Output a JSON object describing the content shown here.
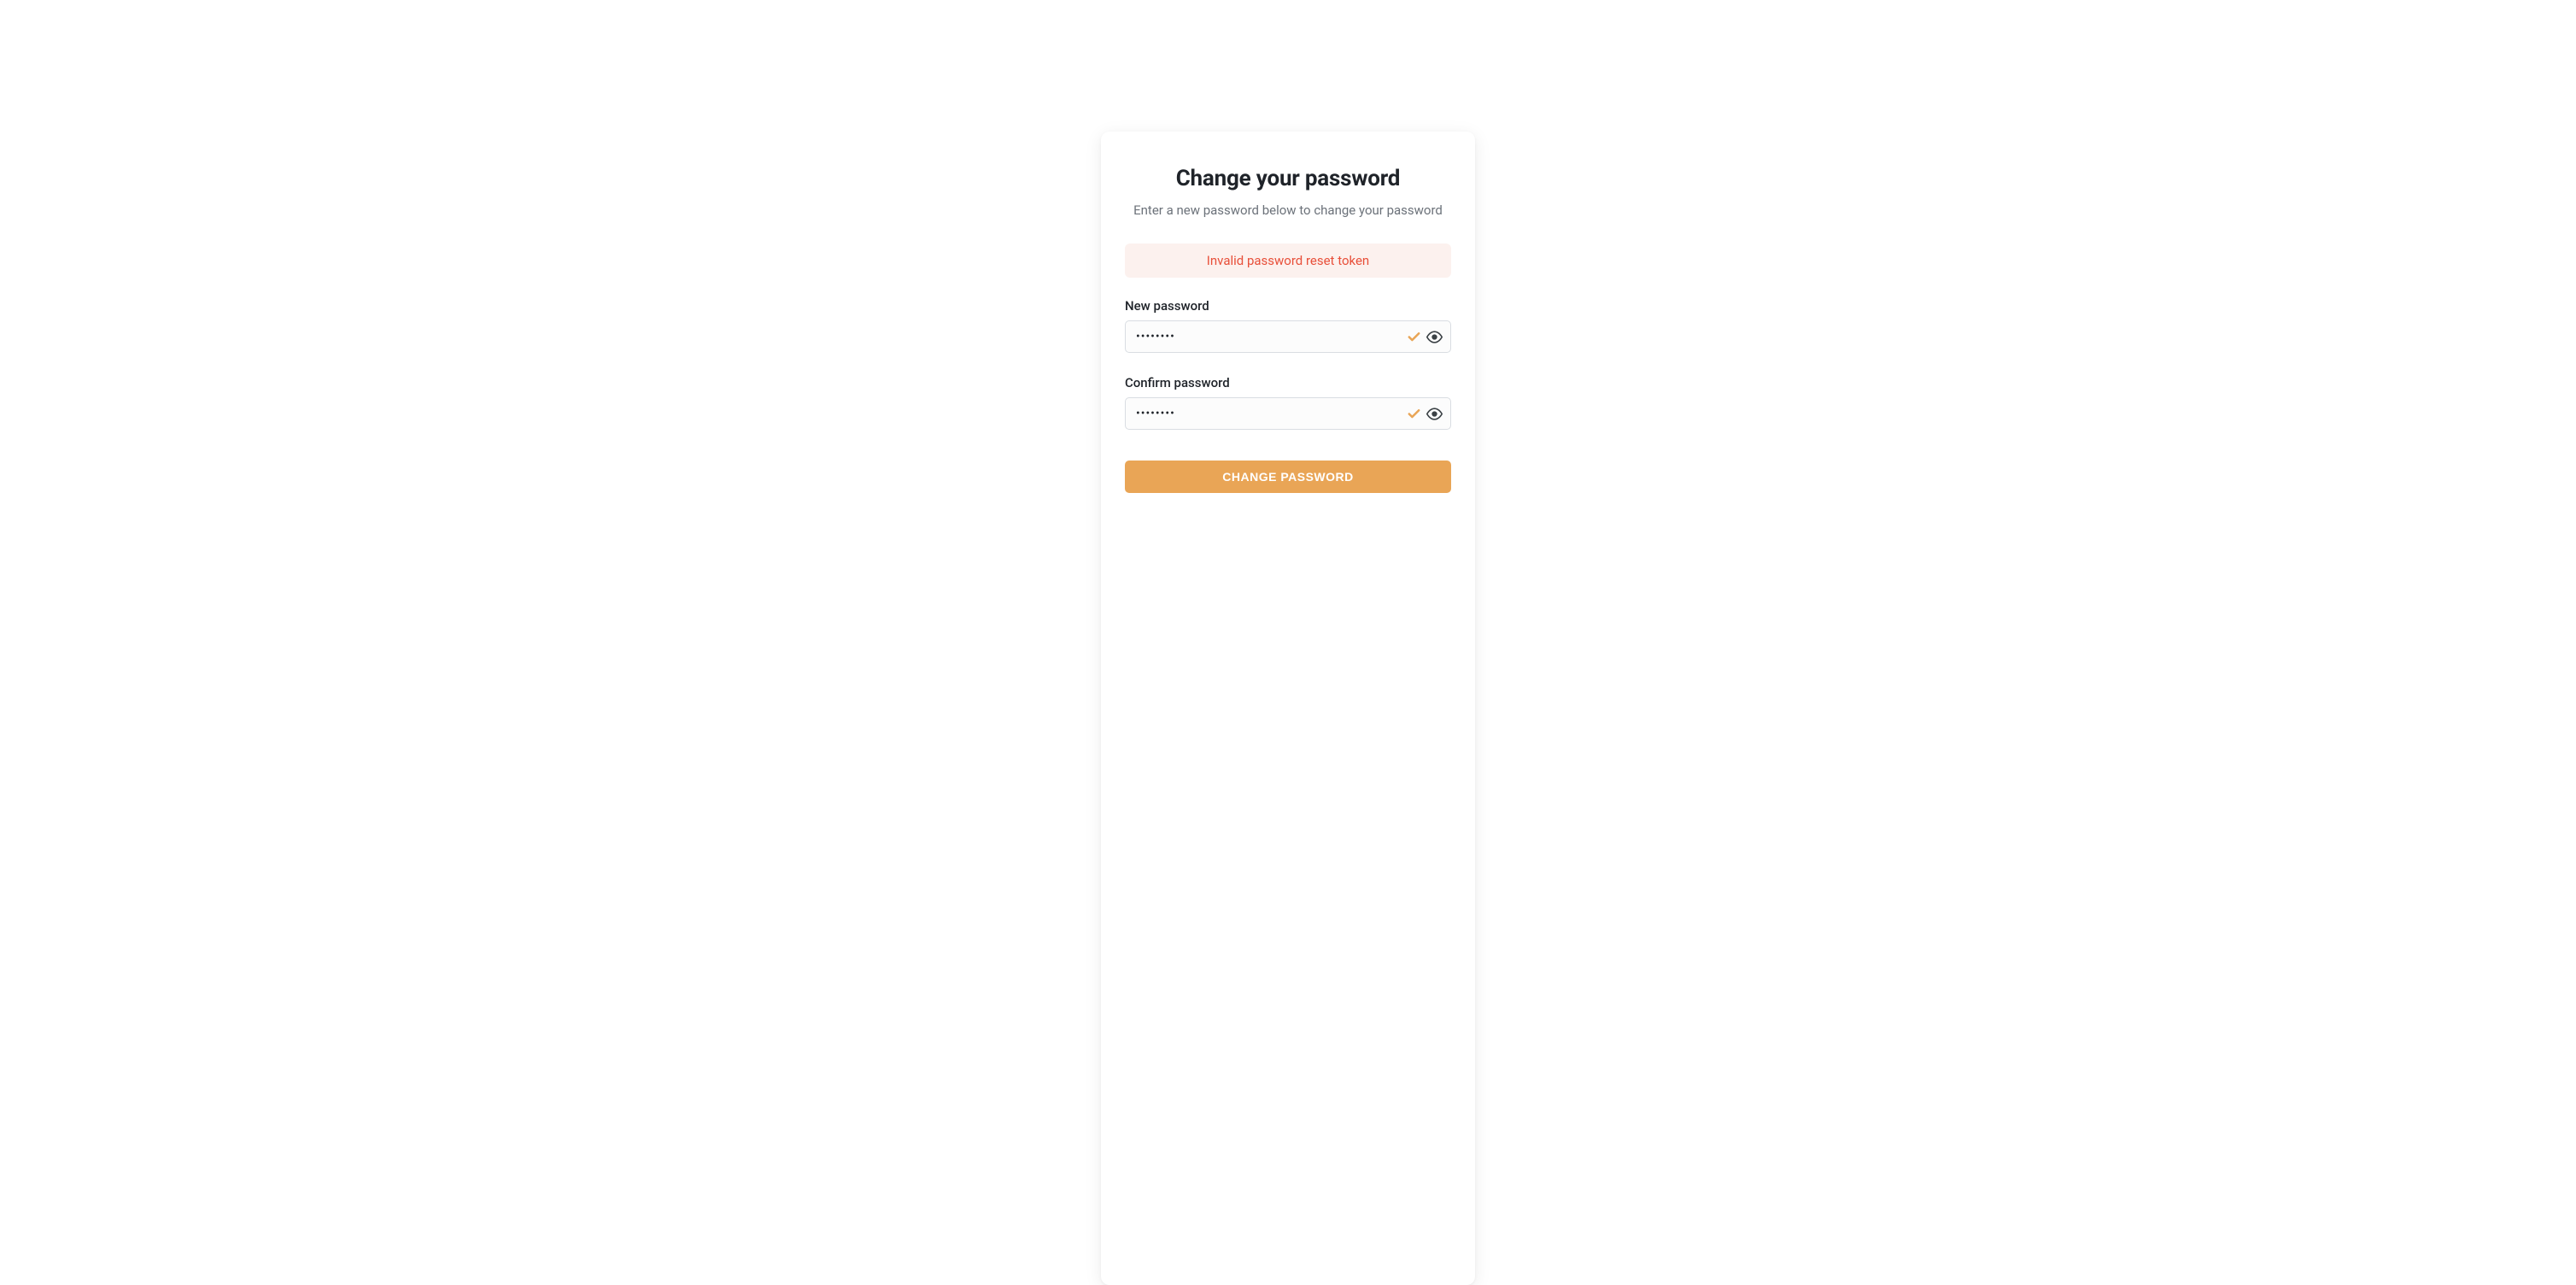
{
  "title": "Change your password",
  "subtitle": "Enter a new password below to change your password",
  "alert": "Invalid password reset token",
  "fields": {
    "new_password": {
      "label": "New password",
      "value": "••••••••"
    },
    "confirm_password": {
      "label": "Confirm password",
      "value": "••••••••"
    }
  },
  "submit_label": "CHANGE PASSWORD",
  "colors": {
    "accent": "#e9a556",
    "error_text": "#e84f39",
    "error_bg": "#fcf1ee"
  }
}
